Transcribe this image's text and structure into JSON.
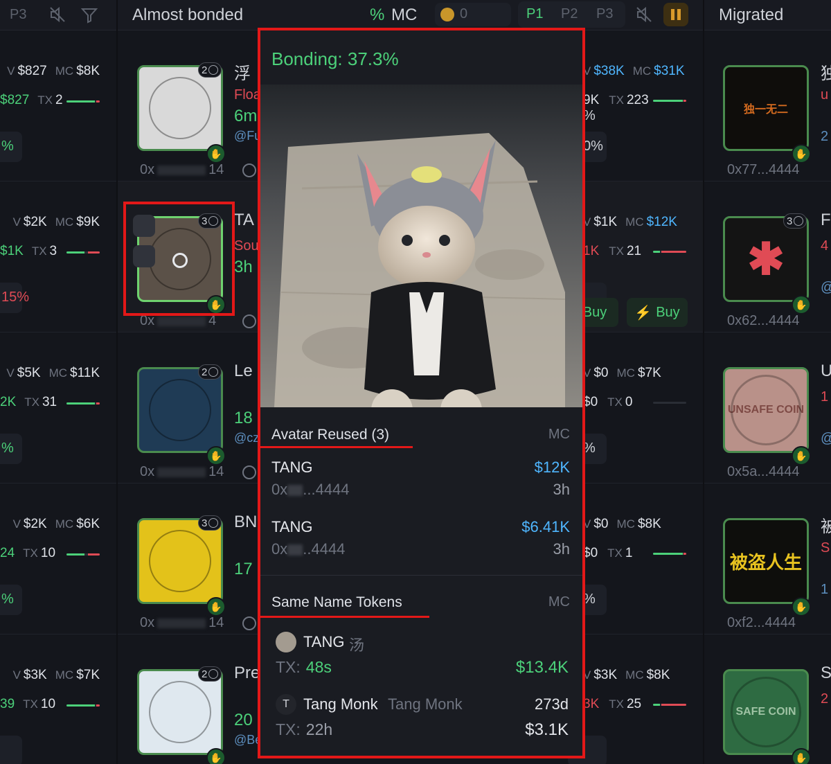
{
  "header": {
    "p3_label": "P3",
    "almost_bonded_title": "Almost bonded",
    "pct_label": "%",
    "mc_label": "MC",
    "coin_count": "0",
    "tabs": [
      "P1",
      "P2",
      "P3"
    ],
    "migrated_title": "Migrated"
  },
  "left_column": [
    {
      "v": "$827",
      "mc": "$8K",
      "vol": "$827",
      "tx": "2",
      "pct": "%",
      "pct_color": "#4cd17a"
    },
    {
      "v": "$2K",
      "mc": "$9K",
      "vol": "$1K",
      "tx": "3",
      "pct": "15%",
      "pct_color": "#e04b55"
    },
    {
      "v": "$5K",
      "mc": "$11K",
      "vol": "2K",
      "tx": "31",
      "pct": "%",
      "pct_color": "#4cd17a"
    },
    {
      "v": "$2K",
      "mc": "$6K",
      "vol": "24",
      "tx": "10",
      "pct": "%",
      "pct_color": "#4cd17a"
    },
    {
      "v": "$3K",
      "mc": "$7K",
      "vol": "39",
      "tx": "10",
      "pct": "",
      "pct_color": "#4cd17a"
    }
  ],
  "labels": {
    "v": "V",
    "mc": "MC",
    "tx": "TX"
  },
  "middle_column": [
    {
      "count": "2",
      "name": "浮",
      "sub": "Floa",
      "age": "6m",
      "handle": "@Fu",
      "addr_start": "0x",
      "addr_end": "14"
    },
    {
      "count": "3",
      "name": "TA",
      "sub": "Sou",
      "age": "3h",
      "handle": "",
      "addr_start": "0x",
      "addr_end": "4"
    },
    {
      "count": "2",
      "name": "Le",
      "sub": "",
      "age": "18",
      "handle": "@cz",
      "addr_start": "0x",
      "addr_end": "14"
    },
    {
      "count": "3",
      "name": "BN",
      "sub": "",
      "age": "17",
      "handle": "",
      "addr_start": "0x",
      "addr_end": "14"
    },
    {
      "count": "2",
      "name": "Pre",
      "sub": "",
      "age": "20",
      "handle": "@Be",
      "addr_start": "",
      "addr_end": ""
    }
  ],
  "right_stats": [
    {
      "v": "$38K",
      "mc": "$31K",
      "vol": "9K",
      "tx": "223",
      "extra": "%",
      "pct": "0%"
    },
    {
      "v": "$1K",
      "mc": "$12K",
      "vol": "1K",
      "tx": "21",
      "extra": "",
      "pct": ""
    },
    {
      "v": "$0",
      "mc": "$7K",
      "vol": "$0",
      "tx": "0",
      "extra": "",
      "pct": "%"
    },
    {
      "v": "$0",
      "mc": "$8K",
      "vol": "$0",
      "tx": "1",
      "extra": "",
      "pct": "%"
    },
    {
      "v": "$3K",
      "mc": "$8K",
      "vol": "3K",
      "tx": "25",
      "extra": "",
      "pct": ""
    }
  ],
  "buy_labels": [
    "Buy",
    "Buy"
  ],
  "migrated": [
    {
      "count": "",
      "logo_text": "独一无二",
      "addr": "0x77...4444",
      "side_a": "独",
      "side_b": "u",
      "side_c": "2"
    },
    {
      "count": "3",
      "logo_text": "✱",
      "addr": "0x62...4444",
      "side_a": "F",
      "side_b": "4",
      "side_c": "@"
    },
    {
      "count": "",
      "logo_text": "UNSAFE COIN",
      "addr": "0x5a...4444",
      "side_a": "U",
      "side_b": "1",
      "side_c": "@"
    },
    {
      "count": "",
      "logo_text": "被盗人生",
      "addr": "0xf2...4444",
      "side_a": "被",
      "side_b": "S",
      "side_c": "1"
    },
    {
      "count": "",
      "logo_text": "SAFE COIN",
      "addr": "",
      "side_a": "S",
      "side_b": "2",
      "side_c": ""
    }
  ],
  "popup": {
    "bonding": "Bonding: 37.3%",
    "avatar_reused_title": "Avatar Reused (3)",
    "mc_header": "MC",
    "avatar_reused": [
      {
        "name": "TANG",
        "addr_start": "0x",
        "addr_end": "...4444",
        "mc": "$12K",
        "age": "3h"
      },
      {
        "name": "TANG",
        "addr_start": "0x",
        "addr_end": "..4444",
        "mc": "$6.41K",
        "age": "3h"
      }
    ],
    "same_name_title": "Same Name Tokens",
    "same_name": [
      {
        "avatar": "",
        "name": "TANG",
        "alt": "汤",
        "tx_label": "TX:",
        "tx": "48s",
        "right_top": "",
        "mc": "$13.4K"
      },
      {
        "avatar": "T",
        "name": "Tang Monk",
        "alt": "Tang Monk",
        "tx_label": "TX:",
        "tx": "22h",
        "right_top": "273d",
        "mc": "$3.1K"
      }
    ]
  },
  "colors": {
    "accent_green": "#4cd17a",
    "accent_red": "#e04b55",
    "highlight_red": "#e31818",
    "mc_blue": "#4fb6ff"
  }
}
